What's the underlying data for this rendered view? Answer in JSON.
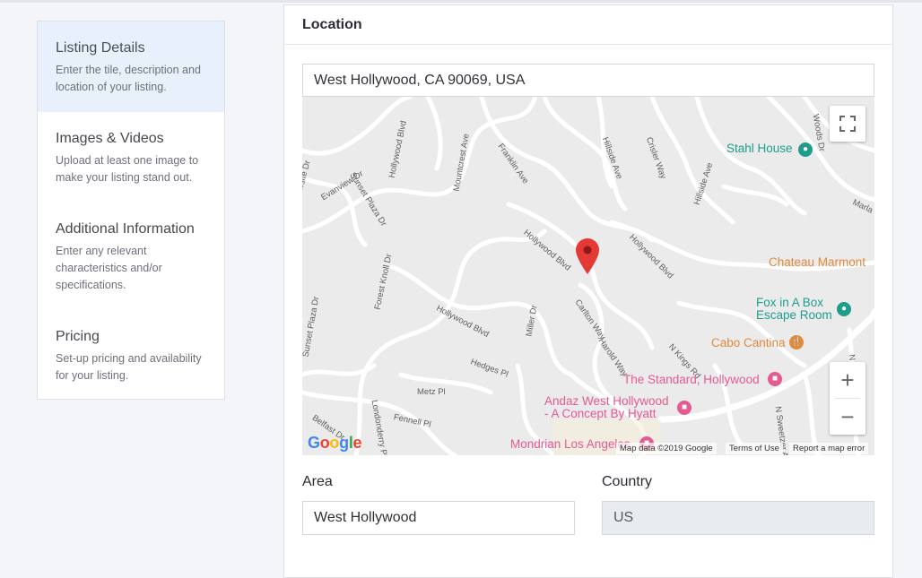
{
  "sidebar": {
    "steps": [
      {
        "title": "Listing Details",
        "desc": "Enter the tile, description and location of your listing."
      },
      {
        "title": "Images & Videos",
        "desc": "Upload at least one image to make your listing stand out."
      },
      {
        "title": "Additional Information",
        "desc": "Enter any relevant characteristics and/or specifications."
      },
      {
        "title": "Pricing",
        "desc": "Set-up pricing and availability for your listing."
      }
    ]
  },
  "location": {
    "title": "Location",
    "address": "West Hollywood, CA 90069, USA"
  },
  "map": {
    "streets": [
      "Sunset Plaza Dr",
      "Evanview Dr",
      "Hollywood Blvd",
      "Mountcrest Ave",
      "Franklin Ave",
      "Hillside Ave",
      "Crisler Way",
      "Hillside Ave",
      "Woods Dr",
      "Marla",
      "Hollywood Blvd",
      "Hollywood Blvd",
      "Forest Knoll Dr",
      "Hollywood Blvd",
      "Carlton Way",
      "Miller Dr",
      "Harold Way",
      "N Kings Rd",
      "Sunset Plaza Dr",
      "Hedges Pl",
      "Metz Pl",
      "Londonderry Pl",
      "Fennell Pl",
      "Belfast Dr",
      "N Sweetzer Ave",
      "N Harp",
      "Viewsite Dr"
    ],
    "pois": {
      "stahl": "Stahl House",
      "chateau": "Chateau Marmont",
      "fox": "Fox in A Box\nEscape Room",
      "cabo": "Cabo Cantina",
      "standard": "The Standard, Hollywood",
      "andaz": "Andaz West Hollywood\n- A Concept By Hyatt",
      "mondrian": "Mondrian Los Angeles"
    },
    "attribution": {
      "data": "Map data ©2019 Google",
      "terms": "Terms of Use",
      "report": "Report a map error"
    },
    "logo": "Google",
    "controls": {
      "zoom_in": "+",
      "zoom_out": "−"
    },
    "colors": {
      "marker": "#e53935",
      "poi_green": "#1f9d8c",
      "poi_orange": "#e08a3c",
      "poi_pink": "#e45a93"
    }
  },
  "fields": {
    "area_label": "Area",
    "area_value": "West Hollywood",
    "country_label": "Country",
    "country_value": "US"
  }
}
